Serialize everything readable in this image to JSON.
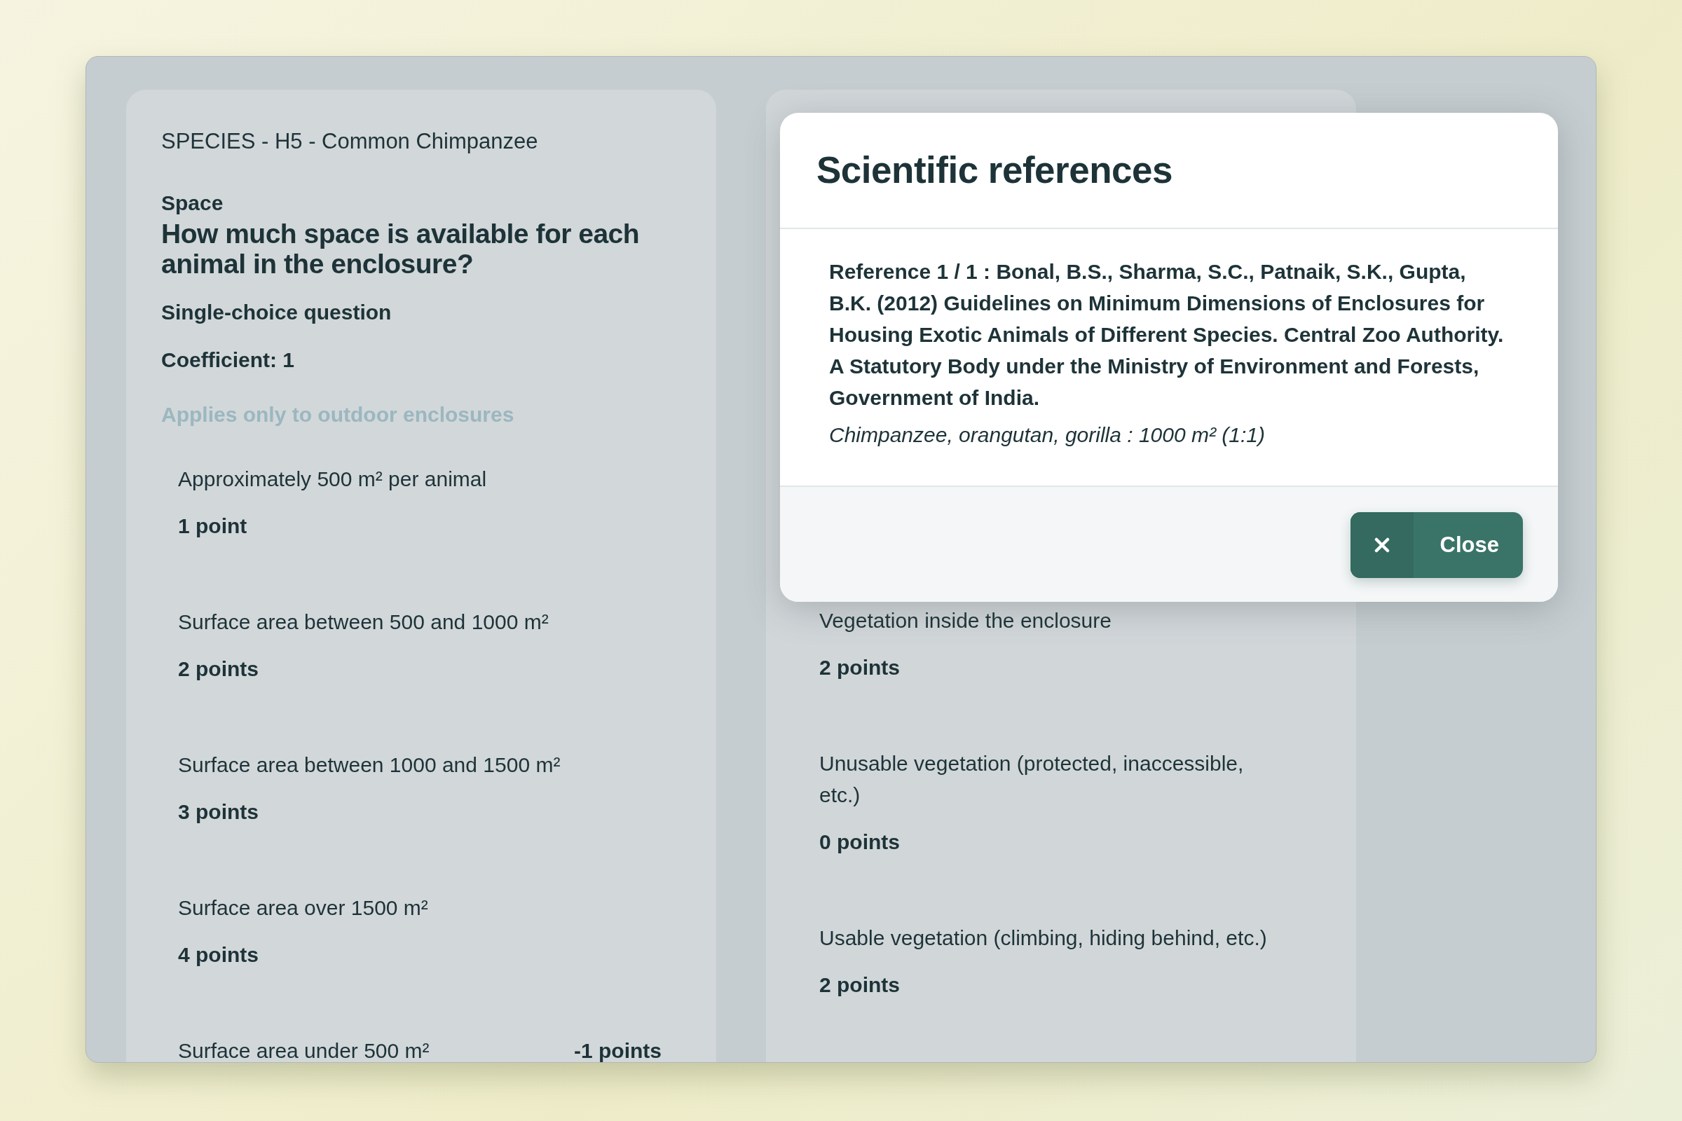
{
  "question": {
    "subject": "SPECIES - H5 - Common Chimpanzee",
    "category": "Space",
    "title": "How much space is available for each animal in the enclosure?",
    "type": "Single-choice question",
    "coefficient": "Coefficient: 1",
    "condition": "Applies only to outdoor enclosures",
    "options": [
      {
        "label": "Approximately 500 m² per animal",
        "points": "1 point",
        "kind": "stacked"
      },
      {
        "label": "Surface area between 500 and 1000 m²",
        "points": "2 points",
        "kind": "stacked"
      },
      {
        "label": "Surface area between 1000 and 1500 m²",
        "points": "3 points",
        "kind": "stacked"
      },
      {
        "label": "Surface area over 1500 m²",
        "points": "4 points",
        "kind": "stacked"
      },
      {
        "label": "Surface area under 500 m²",
        "points": "-1 points",
        "kind": "inline"
      }
    ]
  },
  "second_question": {
    "options": [
      {
        "label": "Vegetation inside the enclosure",
        "points": "2 points"
      },
      {
        "label": "Unusable vegetation (protected, inaccessible, etc.)",
        "points": "0 points"
      },
      {
        "label": "Usable vegetation (climbing, hiding behind, etc.)",
        "points": "2 points"
      }
    ]
  },
  "modal": {
    "title": "Scientific references",
    "reference": "Reference 1 / 1 : Bonal, B.S., Sharma, S.C., Patnaik, S.K., Gupta, B.K. (2012) Guidelines on Minimum Dimensions of Enclosures for Housing Exotic Animals of Different Species. Central Zoo Authority. A Statutory Body under the Ministry of Environment and Forests, Government of India.",
    "note": "Chimpanzee, orangutan, gorilla : 1000 m² (1:1)",
    "close_label": "Close"
  }
}
